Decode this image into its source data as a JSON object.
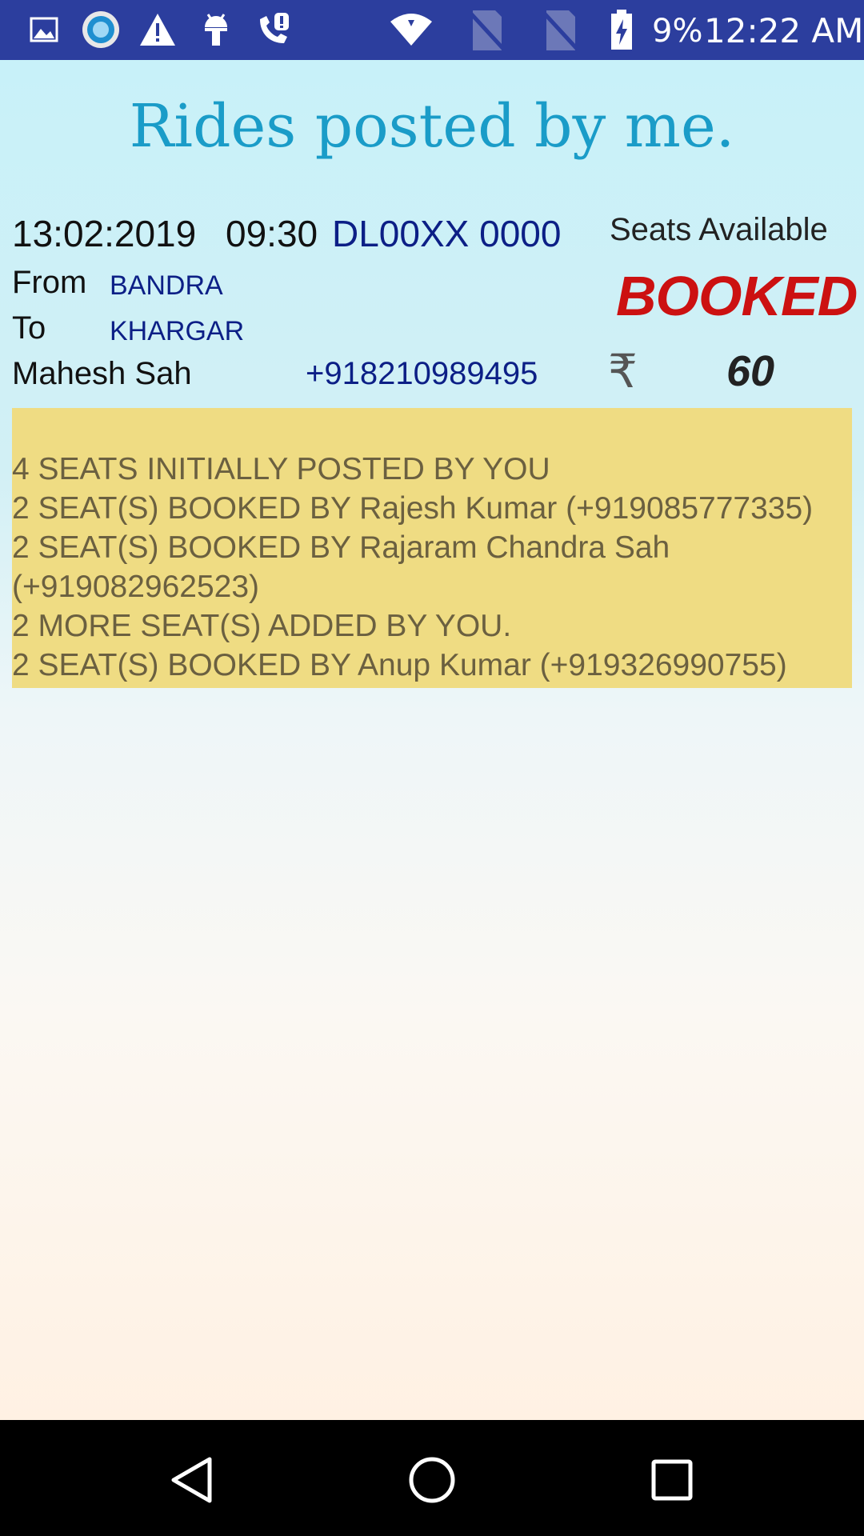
{
  "status_bar": {
    "battery": "9%",
    "time": "12:22 AM",
    "icons": [
      "gallery-icon",
      "app-icon",
      "warning-icon",
      "android-debug-icon",
      "call-alert-icon",
      "wifi-icon",
      "no-sim-icon",
      "no-sim-icon",
      "battery-icon"
    ]
  },
  "page": {
    "title": "Rides posted by me."
  },
  "ride": {
    "date": "13:02:2019",
    "time": "09:30",
    "vehicle": "DL00XX 0000",
    "seats_label": "Seats Available",
    "status": "BOOKED",
    "from_label": "From",
    "from": "BANDRA",
    "to_label": "To",
    "to": "KHARGAR",
    "driver_name": "Mahesh Sah",
    "driver_phone": "+918210989495",
    "currency_symbol": "₹",
    "price": "60",
    "details": [
      "4 SEATS INITIALLY POSTED BY YOU",
      "2 SEAT(S) BOOKED BY Rajesh Kumar (+919085777335)",
      "2 SEAT(S) BOOKED BY Rajaram Chandra Sah",
      "(+919082962523)",
      "2 MORE SEAT(S) ADDED BY YOU.",
      "2 SEAT(S) BOOKED BY Anup Kumar (+919326990755)"
    ]
  },
  "colors": {
    "status_bar": "#2c3e9e",
    "title": "#1a9cc8",
    "booked": "#cc1111",
    "navy_text": "#0c1f86",
    "details_bg": "#efdc83"
  }
}
